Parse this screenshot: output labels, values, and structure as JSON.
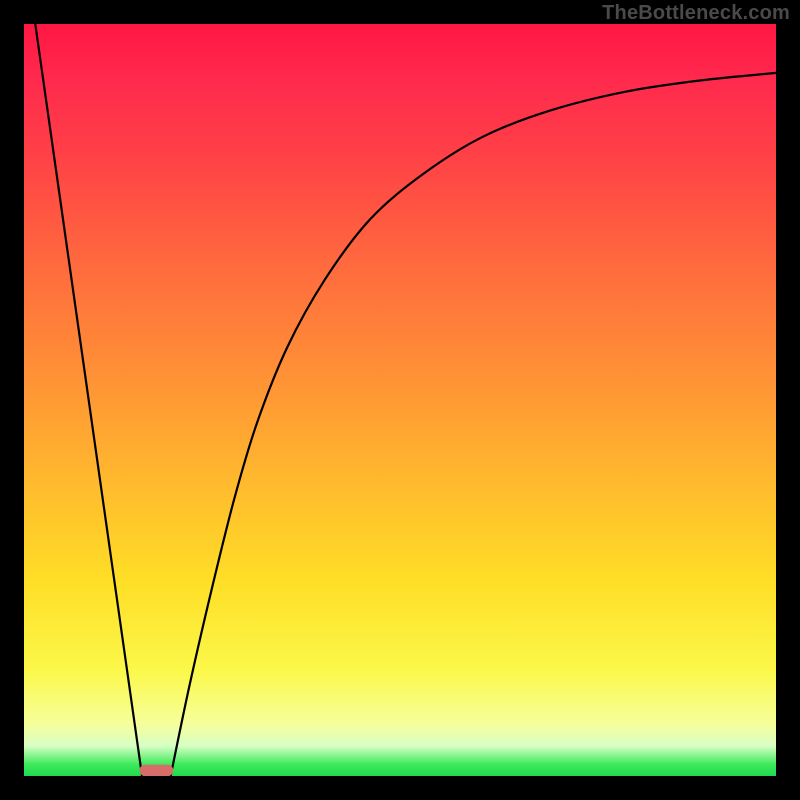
{
  "watermark": "TheBottleneck.com",
  "chart_data": {
    "type": "line",
    "title": "",
    "xlabel": "",
    "ylabel": "",
    "xlim": [
      0,
      1
    ],
    "ylim": [
      0,
      1
    ],
    "series": [
      {
        "name": "left-descent",
        "x": [
          0.015,
          0.157
        ],
        "values": [
          1.0,
          0.0
        ]
      },
      {
        "name": "right-curve",
        "x": [
          0.195,
          0.22,
          0.25,
          0.28,
          0.31,
          0.35,
          0.4,
          0.46,
          0.53,
          0.61,
          0.7,
          0.8,
          0.9,
          1.0
        ],
        "values": [
          0.0,
          0.12,
          0.25,
          0.37,
          0.47,
          0.57,
          0.66,
          0.74,
          0.8,
          0.85,
          0.885,
          0.91,
          0.925,
          0.935
        ]
      }
    ],
    "marker": {
      "name": "optimum-pill",
      "x_center": 0.176,
      "y": 0.0,
      "width": 0.045,
      "height": 0.015,
      "color": "#d96b68"
    },
    "background_gradient": {
      "stops": [
        {
          "pos": 0.0,
          "color": "#ff1744"
        },
        {
          "pos": 0.46,
          "color": "#ff8f36"
        },
        {
          "pos": 0.86,
          "color": "#fbf84a"
        },
        {
          "pos": 0.985,
          "color": "#3bea5a"
        },
        {
          "pos": 1.0,
          "color": "#22d84e"
        }
      ]
    }
  }
}
